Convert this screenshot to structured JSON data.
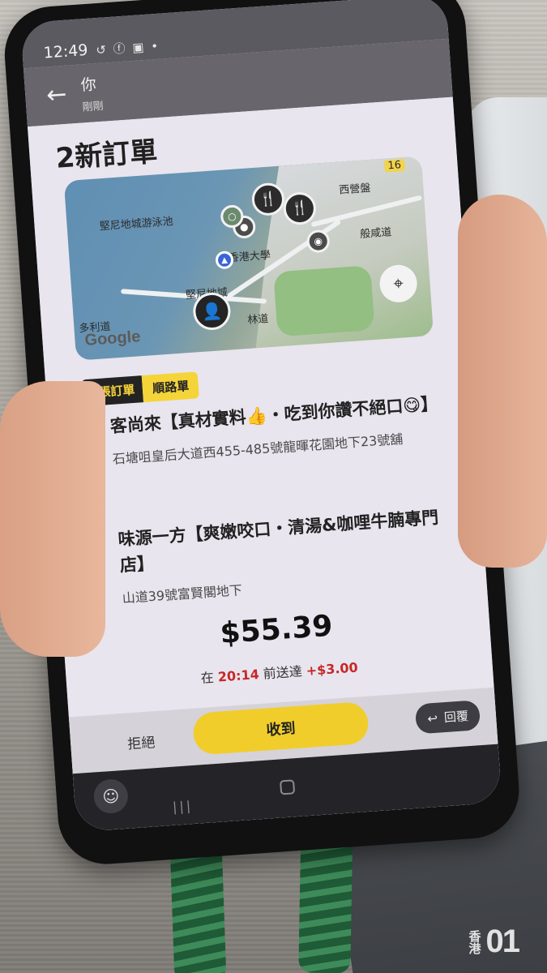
{
  "status_bar": {
    "time": "12:49",
    "icons": "↺ ⓕ ▣ •"
  },
  "notification_bar": {
    "title": "你",
    "subtitle": "剛剛"
  },
  "page": {
    "title": "2新訂單"
  },
  "map": {
    "labels": {
      "pool": "堅尼地城游泳池",
      "university": "香港大學",
      "sai_ying_pun": "西營盤",
      "hospital": "般咸道",
      "kennedy_town": "堅尼地城",
      "street": "多利道",
      "road": "林道",
      "route_badge": "16"
    },
    "provider": "Google"
  },
  "tags": {
    "orders": "2張訂單",
    "route": "順路單"
  },
  "stops": [
    {
      "name": "客尚來【真材實料👍・吃到你讚不絕口😋】",
      "address": "石塘咀皇后大道西455-485號龍暉花園地下23號舖"
    },
    {
      "name": "味源一方【爽嫩咬口・清湯&咖哩牛腩專門店】",
      "address": "山道39號富賢閣地下"
    }
  ],
  "payout": {
    "amount": "$55.39",
    "deadline_prefix": "在",
    "deadline_time": "20:14",
    "deadline_suffix": "前送達",
    "bonus": "+$3.00"
  },
  "actions": {
    "reject": "拒絕",
    "accept": "收到",
    "reply": "回覆"
  },
  "watermark": {
    "text": "香港",
    "logo": "01"
  },
  "colors": {
    "accent": "#f1cd2c",
    "dark": "#232323",
    "deadline_red": "#c62828"
  }
}
